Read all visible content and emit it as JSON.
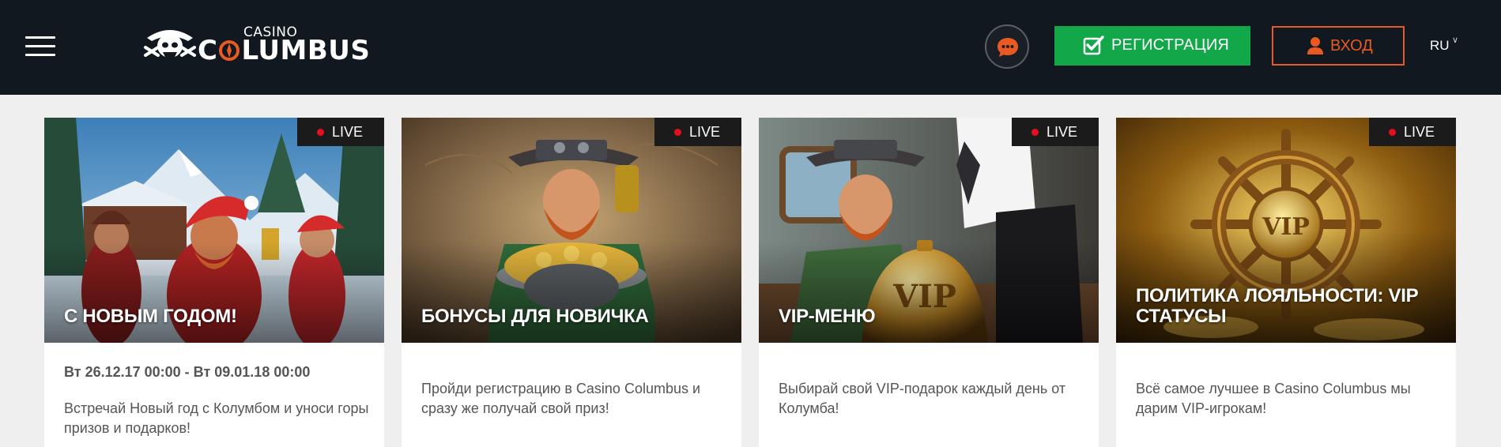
{
  "header": {
    "logo_small": "CASINO",
    "logo_word_pre": "C",
    "logo_word_post": "LUMBUS",
    "register_label": "РЕГИСТРАЦИЯ",
    "login_label": "ВХОД",
    "language": "RU",
    "colors": {
      "background": "#111820",
      "register": "#12a84a",
      "login": "#e85a21",
      "chat": "#e85a21"
    }
  },
  "cards": [
    {
      "live": "LIVE",
      "title": "С НОВЫМ ГОДОМ!",
      "date": "Вт 26.12.17 00:00 - Вт 09.01.18 00:00",
      "description": "Встречай Новый год с Колумбом и уноси горы призов и подарков!"
    },
    {
      "live": "LIVE",
      "title": "БОНУСЫ ДЛЯ НОВИЧКА",
      "date": "",
      "description": "Пройди регистрацию в Casino Columbus и сразу же получай свой приз!"
    },
    {
      "live": "LIVE",
      "title": "VIP-МЕНЮ",
      "date": "",
      "description": "Выбирай свой VIP-подарок каждый день от Колумба!"
    },
    {
      "live": "LIVE",
      "title": "ПОЛИТИКА ЛОЯЛЬНОСТИ: VIP СТАТУСЫ",
      "date": "",
      "description": "Всё самое лучшее в Casino Columbus мы дарим VIP-игрокам!"
    }
  ]
}
